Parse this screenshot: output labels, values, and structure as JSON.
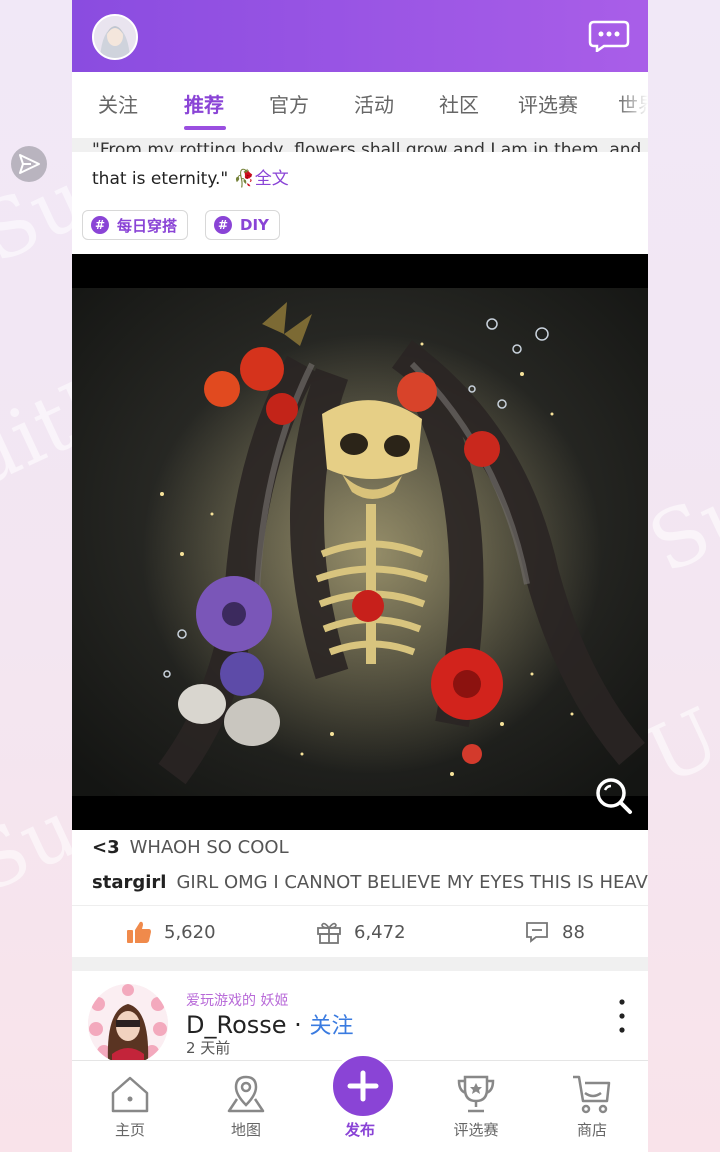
{
  "tabs": [
    "关注",
    "推荐",
    "官方",
    "活动",
    "社区",
    "评选赛",
    "世界"
  ],
  "active_tab": "推荐",
  "post": {
    "quote_cut": "\"From my rotting body, flowers shall grow and I am in them, and",
    "quote_line": "that is eternity.\" 🥀",
    "full_text_link": "全文",
    "tags": [
      "每日穿搭",
      "DIY"
    ],
    "comments": [
      {
        "user": "<3",
        "text": "WHAOH SO COOL"
      },
      {
        "user": "stargirl",
        "text": "GIRL OMG I CANNOT BELIEVE MY EYES THIS IS HEAVENL…"
      }
    ],
    "likes": "5,620",
    "gifts": "6,472",
    "comment_count": "88"
  },
  "next_post": {
    "title_badge": "爱玩游戏的 妖姬",
    "username": "D_Rosse",
    "separator": " · ",
    "follow_label": "关注",
    "time": "2 天前"
  },
  "nav": {
    "home": "主页",
    "map": "地图",
    "publish": "发布",
    "contest": "评选赛",
    "shop": "商店"
  },
  "watermark_text": "SuitU",
  "colors": {
    "accent": "#8a44d6",
    "link": "#3a7be0",
    "like": "#f08a4b"
  }
}
